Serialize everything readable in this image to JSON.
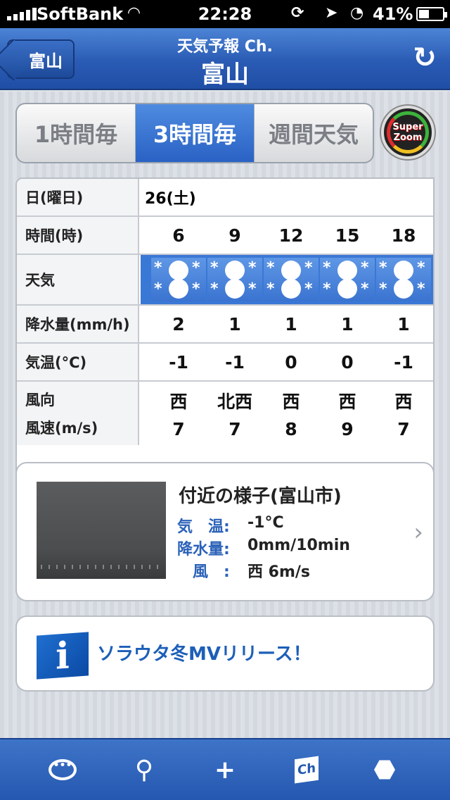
{
  "status": {
    "carrier": "SoftBank",
    "time": "22:28",
    "battery": "41%",
    "battery_fraction": 0.41
  },
  "nav": {
    "back_label": "富山",
    "subtitle": "天気予報 Ch.",
    "title": "富山"
  },
  "segments": [
    "1時間毎",
    "3時間毎",
    "週間天気"
  ],
  "selected_segment": "3時間毎",
  "zoom": {
    "line1": "Super",
    "line2": "Zoom"
  },
  "forecast": {
    "labels": {
      "date": "日(曜日)",
      "hour": "時間(時)",
      "weather": "天気",
      "precip": "降水量(mm/h)",
      "temp": "気温(°C)",
      "wind_dir": "風向",
      "wind_speed": "風速(m/s)"
    },
    "date": "26(土)",
    "hours": [
      "6",
      "9",
      "12",
      "15",
      "18"
    ],
    "weather": [
      "snow",
      "snow",
      "snow",
      "snow",
      "snow"
    ],
    "precip": [
      "2",
      "1",
      "1",
      "1",
      "1"
    ],
    "temp": [
      "-1",
      "-1",
      "0",
      "0",
      "-1"
    ],
    "wind_dir": [
      "西",
      "北西",
      "西",
      "西",
      "西"
    ],
    "wind_speed": [
      "7",
      "7",
      "8",
      "9",
      "7"
    ]
  },
  "live": {
    "title": "付近の様子(富山市)",
    "rows": [
      {
        "key": "気　温:",
        "value": "-1°C"
      },
      {
        "key": "降水量:",
        "value": "0mm/10min"
      },
      {
        "key": "　風　:",
        "value": "西 6m/s"
      }
    ]
  },
  "news": {
    "icon_letter": "i",
    "text": "ソラウタ冬MVリリース！"
  },
  "tabbar": {
    "icons": [
      "chat-bubble-icon",
      "search-icon",
      "add-icon",
      "channel-icon",
      "settings-hex-icon"
    ],
    "ch_label": "Ch",
    "chat_dots": "•••"
  }
}
